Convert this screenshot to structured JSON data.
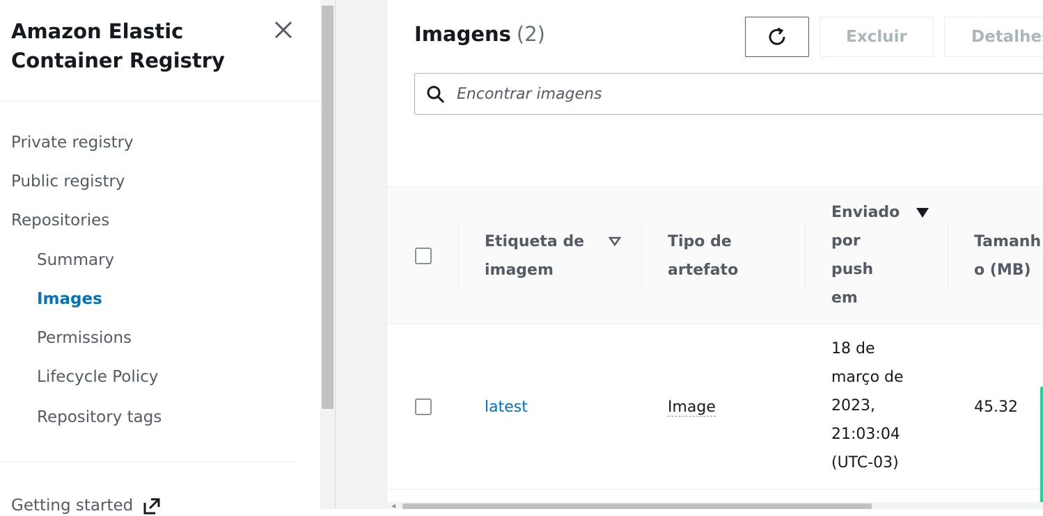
{
  "sidebar": {
    "title": "Amazon Elastic Container Registry",
    "items": [
      {
        "label": "Private registry"
      },
      {
        "label": "Public registry"
      },
      {
        "label": "Repositories"
      },
      {
        "label": "Summary"
      },
      {
        "label": "Images",
        "active": true
      },
      {
        "label": "Permissions"
      },
      {
        "label": "Lifecycle Policy"
      },
      {
        "label": "Repository tags"
      }
    ],
    "getting_started": "Getting started"
  },
  "images_panel": {
    "title": "Imagens",
    "count": "(2)",
    "buttons": {
      "delete": "Excluir",
      "details": "Detalhes"
    },
    "search": {
      "placeholder": "Encontrar imagens"
    },
    "table": {
      "columns": [
        "Etiqueta de imagem",
        "Tipo de artefato",
        "Enviado por push em",
        "Tamanho (MB)"
      ],
      "rows": [
        {
          "tag": "latest",
          "artifact_type": "Image",
          "pushed_at": "18 de março de 2023, 21:03:04 (UTC-03)",
          "size_mb": "45.32"
        }
      ]
    }
  },
  "colors": {
    "link": "#0073bb",
    "text": "#16191f",
    "muted": "#545b64",
    "border": "#aab7b8"
  }
}
